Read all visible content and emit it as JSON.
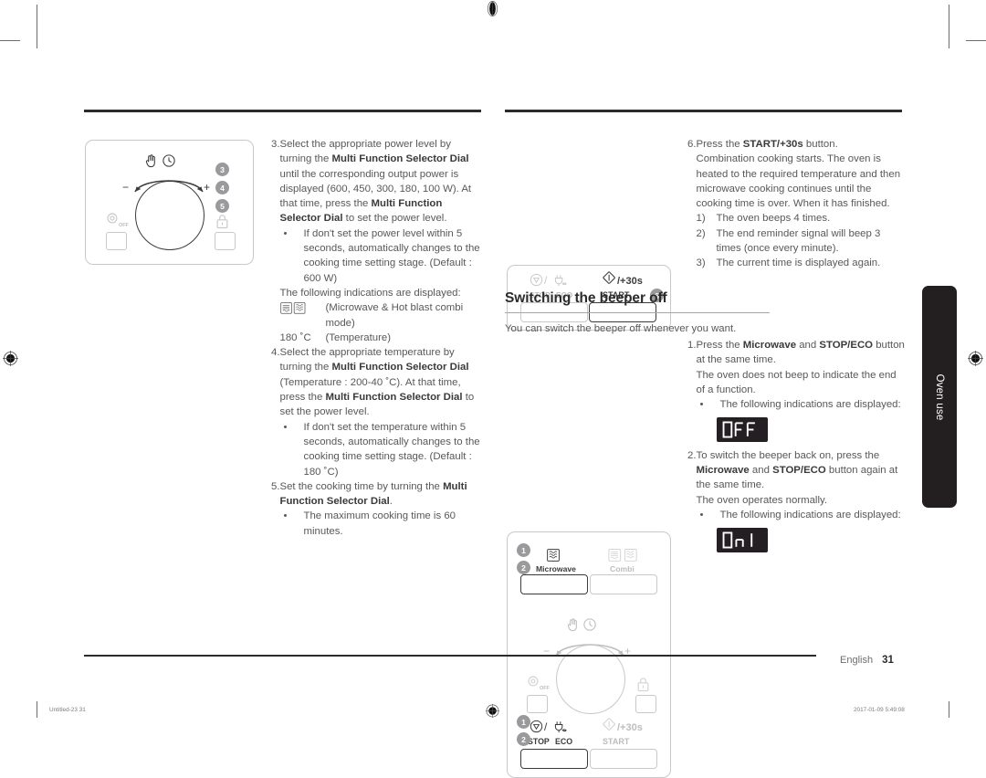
{
  "document": {
    "language_footer": "English",
    "page_number": "31",
    "side_tab_label": "Oven use",
    "print_meta_left": "Untitled-23   31",
    "print_meta_right": "2017-01-09    5:49:08"
  },
  "left_column": {
    "figure": {
      "name": "control-panel-dial-figure",
      "callouts": [
        "3",
        "4",
        "5"
      ],
      "dial_minus": "−",
      "dial_plus": "+",
      "power_off_label": "OFF"
    },
    "steps": [
      {
        "number": "3.",
        "paragraphs": [
          "Select the appropriate power level by turning the <b>Multi Function Selector Dial</b> until the corresponding output power is displayed (600, 450, 300, 180, 100 W). At that time, press the <b>Multi Function Selector Dial</b> to set the power level."
        ],
        "bullets": [
          "If don't set the power level within 5 seconds, automatically changes to the cooking time setting stage. (Default : 600 W)"
        ],
        "trailing": "The following indications are displayed:",
        "indications": [
          {
            "icons": "combi-microwave-hotblast",
            "label": "(Microwave & Hot blast combi mode)"
          },
          {
            "icons": "temperature-text",
            "value": "180 ˚C",
            "label": "(Temperature)"
          }
        ]
      },
      {
        "number": "4.",
        "paragraphs": [
          "Select the appropriate temperature by turning the <b>Multi Function Selector Dial</b> (Temperature : 200-40 ˚C). At that time, press the <b>Multi Function Selector Dial</b> to set the power level."
        ],
        "bullets": [
          "If don't set the temperature within 5 seconds, automatically changes to the cooking time setting stage. (Default : 180 ˚C)"
        ]
      },
      {
        "number": "5.",
        "paragraphs": [
          "Set the cooking time by turning the <b>Multi Function Selector Dial</b>."
        ],
        "bullets": [
          "The maximum cooking time is 60 minutes."
        ]
      }
    ]
  },
  "middle_column": {
    "figure_top": {
      "name": "start-stop-button-figure",
      "stop_label": "STOP",
      "eco_label": "ECO",
      "start_label": "START",
      "start_plus30_label": "/+30s",
      "callout": "6"
    },
    "section": {
      "heading": "Switching the beeper off",
      "intro": "You can switch the beeper off whenever you want."
    },
    "figure_bottom": {
      "name": "beeper-off-panel-figure",
      "microwave_label": "Microwave",
      "combi_label": "Combi",
      "stop_label": "STOP",
      "eco_label": "ECO",
      "start_label": "START",
      "start_plus30_label": "/+30s",
      "power_off_label": "OFF",
      "callouts_top": [
        "1",
        "2"
      ],
      "callouts_bottom": [
        "1",
        "2"
      ],
      "dial_minus": "−",
      "dial_plus": "+"
    }
  },
  "right_column": {
    "steps": [
      {
        "number": "6.",
        "paragraphs": [
          "Press the <b>START/+30s</b> button.",
          "Combination cooking starts. The oven is heated to the required temperature and then microwave cooking continues until the cooking time is over. When it has finished."
        ],
        "subnumbers": [
          {
            "marker": "1)",
            "text": "The oven beeps 4 times."
          },
          {
            "marker": "2)",
            "text": "The end reminder signal will beep 3 times (once every minute)."
          },
          {
            "marker": "3)",
            "text": "The current time is displayed again."
          }
        ]
      }
    ],
    "beeper_steps": [
      {
        "number": "1.",
        "paragraphs": [
          "Press the <b>Microwave</b> and <b>STOP/ECO</b> button at the same time.",
          "The oven does not beep to indicate the end of a function."
        ],
        "bullets": [
          "The following indications are displayed:"
        ],
        "lcd": "OFF"
      },
      {
        "number": "2.",
        "paragraphs": [
          "To switch the beeper back on, press the <b>Microwave</b> and <b>STOP/ECO</b> button again at the same time.",
          "The oven operates normally."
        ],
        "bullets": [
          "The following indications are displayed:"
        ],
        "lcd": "On"
      }
    ]
  },
  "colors": {
    "rule_dark": "#2b2b2b",
    "body_text": "#58585b",
    "bold_text": "#3a3a3c",
    "callout_grey": "#9a9a9d",
    "panel_border": "#c9c9cc",
    "tab_black": "#231f20",
    "lcd_bg": "#231f23"
  }
}
